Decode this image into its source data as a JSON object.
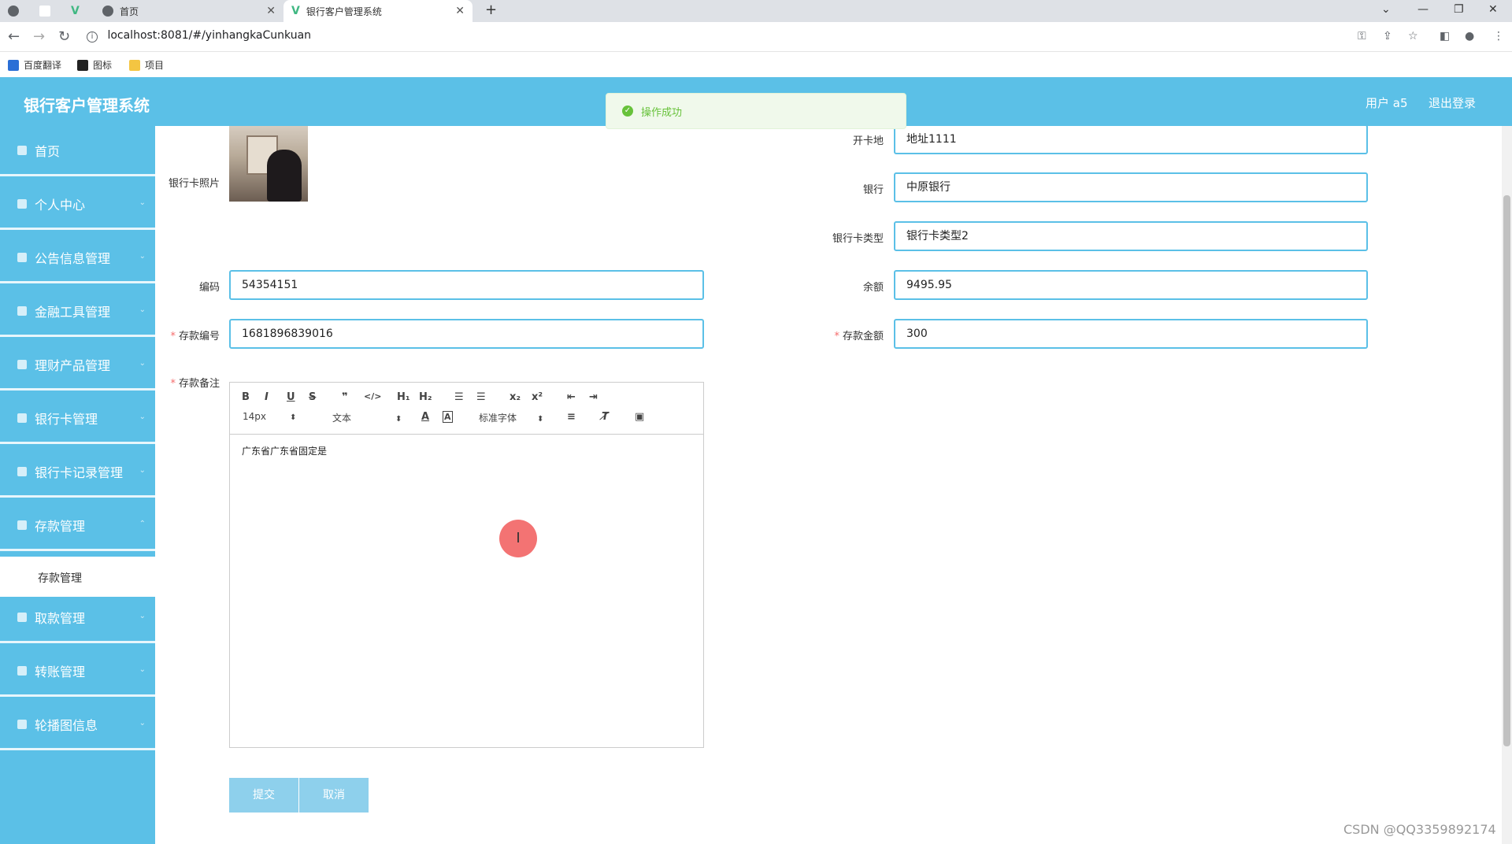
{
  "browser": {
    "tabs": [
      {
        "label": "首页"
      },
      {
        "label": "银行客户管理系统"
      }
    ],
    "url": "localhost:8081/#/yinhangkaCunkuan",
    "bookmarks": [
      "百度翻译",
      "图标",
      "项目"
    ]
  },
  "header": {
    "title": "银行客户管理系统",
    "user": "用户 a5",
    "logout": "退出登录"
  },
  "toast": {
    "message": "操作成功"
  },
  "sidebar": {
    "items": [
      {
        "label": "首页"
      },
      {
        "label": "个人中心"
      },
      {
        "label": "公告信息管理"
      },
      {
        "label": "金融工具管理"
      },
      {
        "label": "理财产品管理"
      },
      {
        "label": "银行卡管理"
      },
      {
        "label": "银行卡记录管理"
      },
      {
        "label": "存款管理"
      },
      {
        "label": "取款管理"
      },
      {
        "label": "转账管理"
      },
      {
        "label": "轮播图信息"
      }
    ],
    "submenu": "存款管理"
  },
  "form": {
    "photo_label": "银行卡照片",
    "kaika_label": "开卡地",
    "kaika_value": "地址1111",
    "bank_label": "银行",
    "bank_value": "中原银行",
    "cardtype_label": "银行卡类型",
    "cardtype_value": "银行卡类型2",
    "code_label": "编码",
    "code_value": "54354151",
    "balance_label": "余额",
    "balance_value": "9495.95",
    "deposit_no_label": "存款编号",
    "deposit_no_value": "1681896839016",
    "deposit_amount_label": "存款金额",
    "deposit_amount_value": "300",
    "remark_label": "存款备注",
    "remark_value": "广东省广东省固定是"
  },
  "editor": {
    "font_size": "14px",
    "block": "文本",
    "font": "标准字体"
  },
  "buttons": {
    "submit": "提交",
    "cancel": "取消"
  },
  "watermark": "CSDN @QQ3359892174"
}
